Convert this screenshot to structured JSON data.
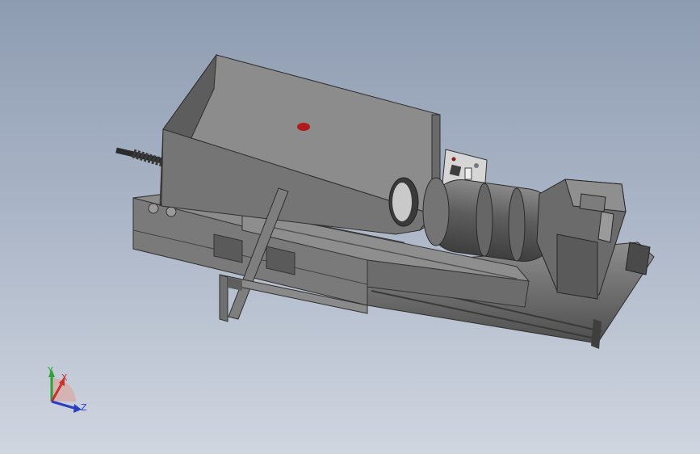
{
  "scene": {
    "description_colors": {
      "body_top": "#8c8c8c",
      "body_front": "#6f6f6f",
      "body_side": "#5e5e5e",
      "indicator": "#b01a1a",
      "rail": "#7a7a7a",
      "motor": "#6a6a6a"
    }
  },
  "triad": {
    "x_label": "X",
    "y_label": "Y",
    "z_label": "Z",
    "x_color": "#c8322b",
    "y_color": "#2ea23a",
    "z_color": "#2a3fbf"
  }
}
